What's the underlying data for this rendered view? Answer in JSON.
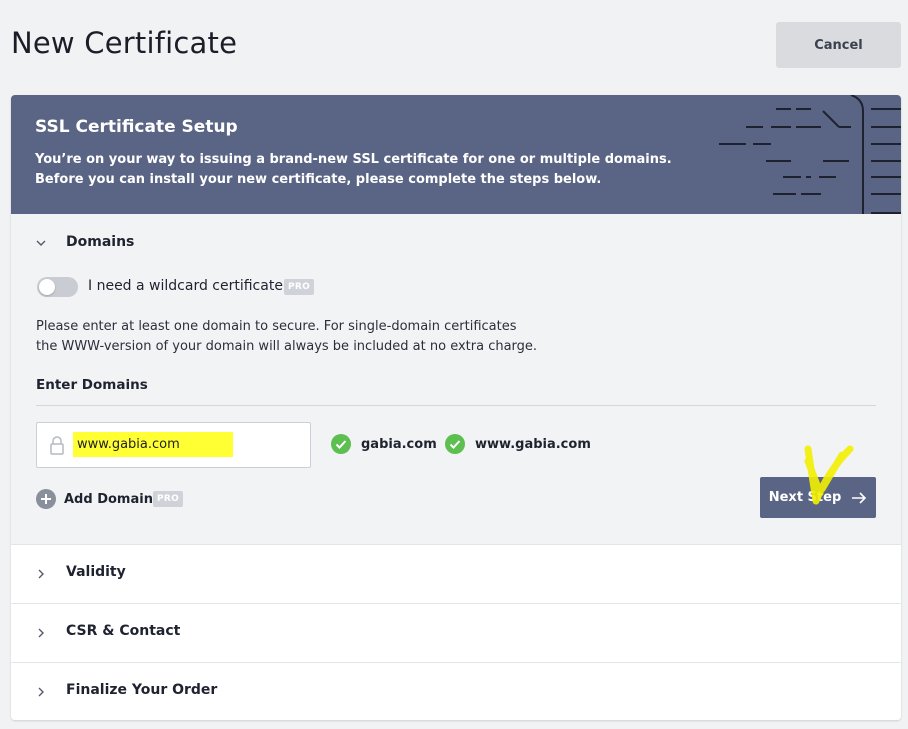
{
  "header": {
    "title": "New Certificate",
    "cancel_label": "Cancel"
  },
  "hero": {
    "title": "SSL Certificate Setup",
    "description_line1": "You’re on your way to issuing a brand-new SSL certificate for one or multiple domains.",
    "description_line2": "Before you can install your new certificate, please complete the steps below."
  },
  "domains": {
    "section_label": "Domains",
    "wildcard_label": "I need a wildcard certificate",
    "wildcard_enabled": false,
    "pro_badge": "PRO",
    "info_line1": "Please enter at least one domain to secure. For single-domain certificates",
    "info_line2": "the WWW-version of your domain will always be included at no extra charge.",
    "enter_label": "Enter Domains",
    "input_value": "www.gabia.com",
    "verified": [
      "gabia.com",
      "www.gabia.com"
    ],
    "add_domain_label": "Add Domain",
    "next_label": "Next Step"
  },
  "sections": [
    {
      "label": "Validity"
    },
    {
      "label": "CSR & Contact"
    },
    {
      "label": "Finalize Your Order"
    }
  ],
  "colors": {
    "accent": "#5a6585",
    "success": "#5cbf4f",
    "highlight": "#ffff33"
  }
}
